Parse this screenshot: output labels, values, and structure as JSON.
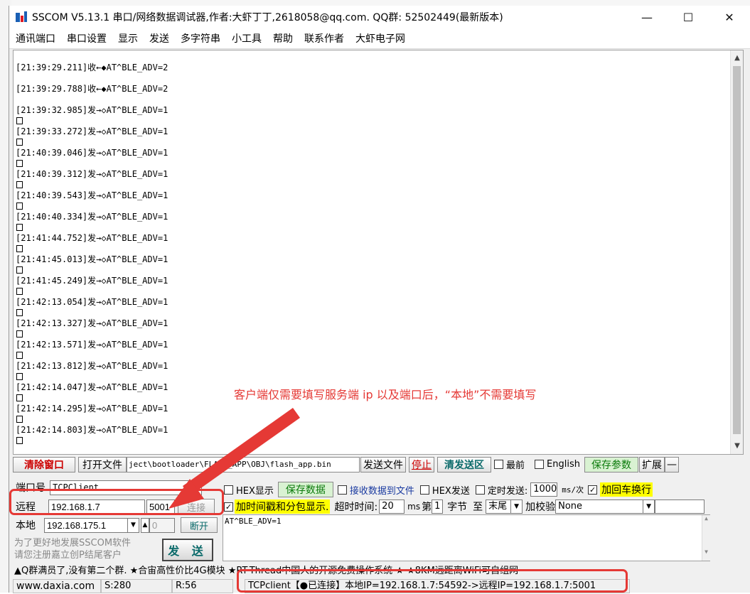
{
  "window": {
    "title": "SSCOM V5.13.1 串口/网络数据调试器,作者:大虾丁丁,2618058@qq.com. QQ群: 52502449(最新版本)",
    "minimize": "—",
    "maximize": "☐",
    "close": "✕"
  },
  "menu": [
    "通讯端口",
    "串口设置",
    "显示",
    "发送",
    "多字符串",
    "小工具",
    "帮助",
    "联系作者",
    "大虾电子网"
  ],
  "receive_lines": [
    "[21:39:29.211]收←◆AT^BLE_ADV=2",
    "[21:39:29.788]收←◆AT^BLE_ADV=2",
    "[21:39:32.985]发→◇AT^BLE_ADV=1",
    "[21:39:33.272]发→◇AT^BLE_ADV=1",
    "[21:40:39.046]发→◇AT^BLE_ADV=1",
    "[21:40:39.312]发→◇AT^BLE_ADV=1",
    "[21:40:39.543]发→◇AT^BLE_ADV=1",
    "[21:40:40.334]发→◇AT^BLE_ADV=1",
    "[21:41:44.752]发→◇AT^BLE_ADV=1",
    "[21:41:45.013]发→◇AT^BLE_ADV=1",
    "[21:41:45.249]发→◇AT^BLE_ADV=1",
    "[21:42:13.054]发→◇AT^BLE_ADV=1",
    "[21:42:13.327]发→◇AT^BLE_ADV=1",
    "[21:42:13.571]发→◇AT^BLE_ADV=1",
    "[21:42:13.812]发→◇AT^BLE_ADV=1",
    "[21:42:14.047]发→◇AT^BLE_ADV=1",
    "[21:42:14.295]发→◇AT^BLE_ADV=1",
    "[21:42:14.803]发→◇AT^BLE_ADV=1"
  ],
  "annotation": "客户端仅需要填写服务端 ip 以及端口后，“本地”不需要填写",
  "toolbar": {
    "clear_window": "清除窗口",
    "open_file": "打开文件",
    "file_path": "ject\\bootloader\\FLASH_APP\\OBJ\\flash_app.bin",
    "send_file": "发送文件",
    "stop": "停止",
    "clear_send": "清发送区",
    "topmost": "最前",
    "english": "English",
    "save_params": "保存参数",
    "expand": "扩展",
    "collapse": "—"
  },
  "left": {
    "port_label": "端口号",
    "port_value": "TCPClient",
    "remote_label": "远程",
    "remote_ip": "192.168.1.7",
    "remote_port": "5001",
    "connect": "连接",
    "local_label": "本地",
    "local_ip": "192.168.175.1",
    "local_port": "0",
    "disconnect": "断开",
    "promo_line1": "为了更好地发展SSCOM软件",
    "promo_line2": "请您注册嘉立创P结尾客户",
    "send": "发 送"
  },
  "right": {
    "hex_display": "HEX显示",
    "save_data": "保存数据",
    "recv_to_file": "接收数据到文件",
    "hex_send": "HEX发送",
    "timed_send": "定时发送:",
    "interval": "1000",
    "interval_unit": "ms/次",
    "add_crlf": "加回车换行",
    "timestamp": "加时间戳和分包显示.",
    "timeout_label": "超时时间:",
    "timeout_value": "20",
    "timeout_unit": "ms",
    "byte_prefix": "第",
    "byte_value": "1",
    "byte_unit": "字节",
    "to": "至",
    "end_value": "末尾",
    "checksum_label": "加校验",
    "checksum_value": "None",
    "send_text": "AT^BLE_ADV=1"
  },
  "ticker": "▲Q群满员了,没有第二个群. ★合宙高性价比4G模块 ★RT-Thread中国人的开源免费操作系统 ★ ★8KM远距离WiFi可自组网",
  "status": {
    "site": "www.daxia.com",
    "sent": "S:280",
    "recv": "R:56",
    "connection": "TCPclient【●已连接】本地IP=192.168.1.7:54592->远程IP=192.168.1.7:5001"
  },
  "colors": {
    "annotation_red": "#e53935",
    "highlight_yellow": "#ffff00",
    "button_green": "#0a7a0a"
  }
}
